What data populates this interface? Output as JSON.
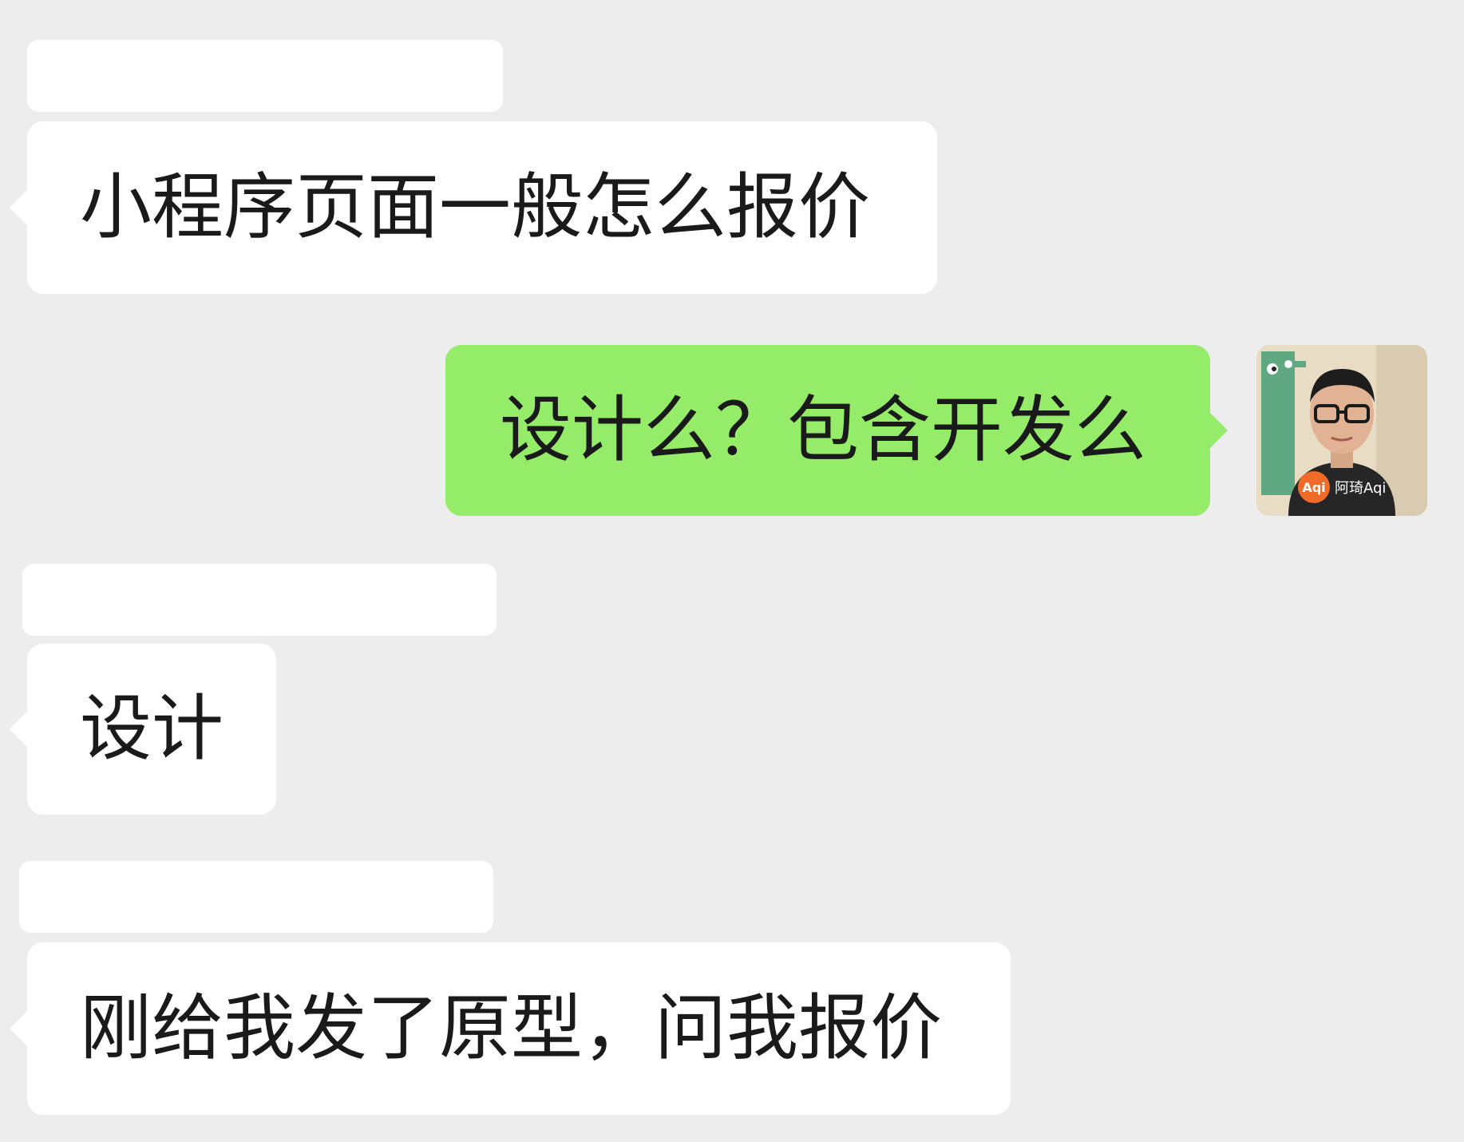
{
  "chat": {
    "messages": [
      {
        "sender": "other",
        "text": "小程序页面一般怎么报价"
      },
      {
        "sender": "self",
        "text": "设计么？包含开发么"
      },
      {
        "sender": "other",
        "text": "设计"
      },
      {
        "sender": "other",
        "text": "刚给我发了原型，问我报价"
      }
    ]
  },
  "self_avatar": {
    "badge": "Aqi",
    "label": "阿琦Aqi"
  },
  "colors": {
    "background": "#ededed",
    "incoming_bubble": "#ffffff",
    "outgoing_bubble": "#95ec69",
    "text": "#1a1a1a"
  }
}
